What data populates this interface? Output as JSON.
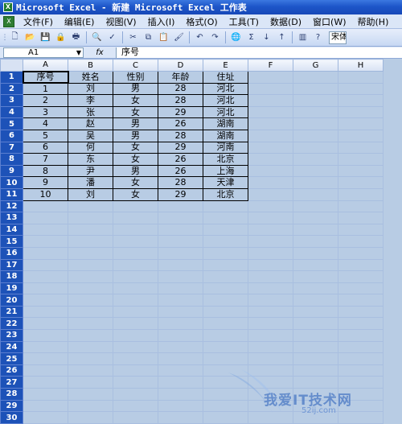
{
  "title": "Microsoft Excel - 新建 Microsoft Excel 工作表",
  "menu": [
    "文件(F)",
    "编辑(E)",
    "视图(V)",
    "插入(I)",
    "格式(O)",
    "工具(T)",
    "数据(D)",
    "窗口(W)",
    "帮助(H)"
  ],
  "toolbar": {
    "font_name": "宋体",
    "icons": [
      "new-icon",
      "open-icon",
      "save-icon",
      "permission-icon",
      "print-icon",
      "print-preview-icon",
      "spelling-icon",
      "cut-icon",
      "copy-icon",
      "paste-icon",
      "format-painter-icon",
      "undo-icon",
      "redo-icon",
      "hyperlink-icon",
      "autosum-icon",
      "sort-ascending-icon",
      "sort-descending-icon",
      "chart-wizard-icon",
      "help-icon"
    ]
  },
  "formula_bar": {
    "name_box": "A1",
    "fx_label": "fx",
    "content": "序号"
  },
  "sheet": {
    "columns": [
      "A",
      "B",
      "C",
      "D",
      "E",
      "F",
      "G",
      "H"
    ],
    "rows": [
      "1",
      "2",
      "3",
      "4",
      "5",
      "6",
      "7",
      "8",
      "9",
      "10",
      "11",
      "12",
      "13",
      "14",
      "15",
      "16",
      "17",
      "18",
      "19",
      "20",
      "21",
      "22",
      "23",
      "24",
      "25",
      "26",
      "27",
      "28",
      "29",
      "30"
    ],
    "header": [
      "序号",
      "姓名",
      "性别",
      "年龄",
      "住址"
    ],
    "data": [
      [
        "1",
        "刘",
        "男",
        "28",
        "河北"
      ],
      [
        "2",
        "李",
        "女",
        "28",
        "河北"
      ],
      [
        "3",
        "张",
        "女",
        "29",
        "河北"
      ],
      [
        "4",
        "赵",
        "男",
        "26",
        "湖南"
      ],
      [
        "5",
        "吴",
        "男",
        "28",
        "湖南"
      ],
      [
        "6",
        "何",
        "女",
        "29",
        "河南"
      ],
      [
        "7",
        "东",
        "女",
        "26",
        "北京"
      ],
      [
        "8",
        "尹",
        "男",
        "26",
        "上海"
      ],
      [
        "9",
        "潘",
        "女",
        "28",
        "天津"
      ],
      [
        "10",
        "刘",
        "女",
        "29",
        "北京"
      ]
    ]
  },
  "watermark": {
    "text": "我爱IT技术网",
    "sub": "52ij.com"
  }
}
